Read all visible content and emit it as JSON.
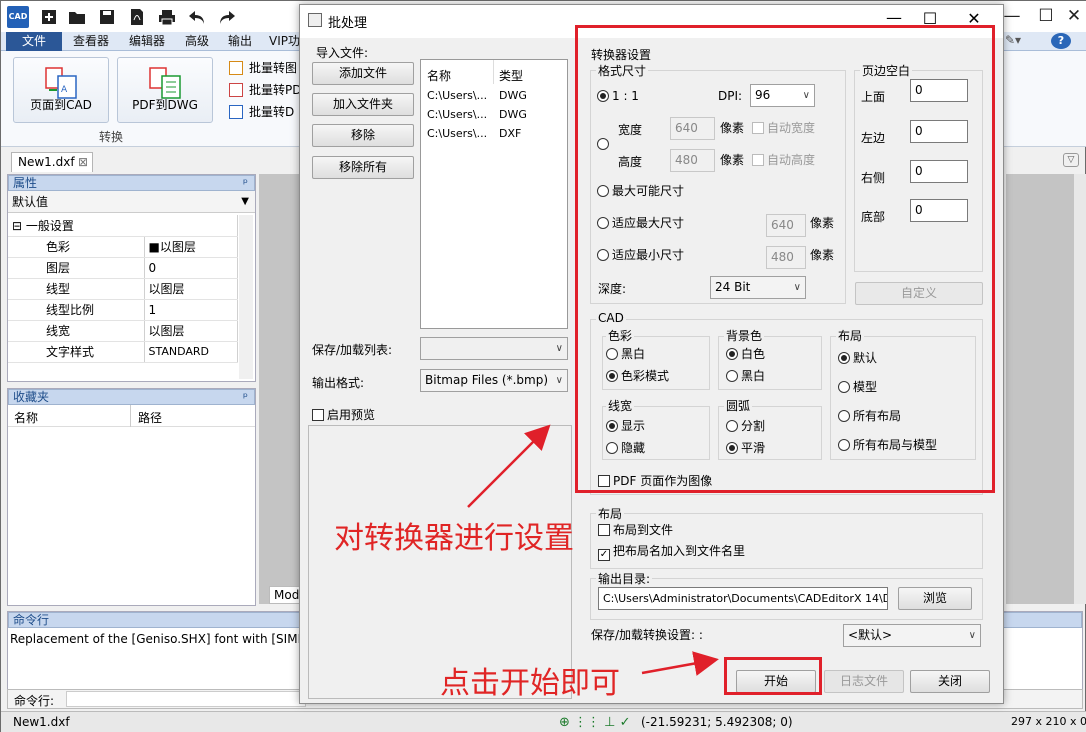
{
  "app": {
    "logo_text": "CAD",
    "menu_tabs": [
      "文件",
      "查看器",
      "编辑器",
      "高级",
      "输出",
      "VIP功"
    ],
    "ribbon": {
      "btn_page_to_cad": "页面到CAD",
      "btn_pdf_to_dwg": "PDF到DWG",
      "group_label": "转换",
      "small_items": [
        "批量转图",
        "批量转PD",
        "批量转D"
      ]
    },
    "doc_tab": "New1.dxf",
    "properties": {
      "title": "属性",
      "selector": "默认值",
      "group": "一般设置",
      "rows": [
        {
          "name": "色彩",
          "value": "■以图层"
        },
        {
          "name": "图层",
          "value": "0"
        },
        {
          "name": "线型",
          "value": "以图层"
        },
        {
          "name": "线型比例",
          "value": "1"
        },
        {
          "name": "线宽",
          "value": "以图层"
        },
        {
          "name": "文字样式",
          "value": "STANDARD"
        }
      ]
    },
    "favorites": {
      "title": "收藏夹",
      "col_name": "名称",
      "col_path": "路径"
    },
    "model_tab": "Mod",
    "command": {
      "title": "命令行",
      "log": "Replacement of the [Geniso.SHX] font with [SIMPLEX.SH",
      "prompt": "命令行:"
    },
    "status": {
      "file": "New1.dxf",
      "coords": "(-21.59231; 5.492308; 0)",
      "paper": "297 x 210 x 0"
    }
  },
  "dialog": {
    "title": "批处理",
    "import_label": "导入文件:",
    "btn_add_file": "添加文件",
    "btn_add_folder": "加入文件夹",
    "btn_remove": "移除",
    "btn_remove_all": "移除所有",
    "files_col_name": "名称",
    "files_col_type": "类型",
    "files": [
      {
        "name": "C:\\Users\\...",
        "type": "DWG"
      },
      {
        "name": "C:\\Users\\...",
        "type": "DWG"
      },
      {
        "name": "C:\\Users\\...",
        "type": "DXF"
      }
    ],
    "save_list_label": "保存/加载列表:",
    "output_format_label": "输出格式:",
    "output_format_value": "Bitmap Files (*.bmp)",
    "preview_label": "启用预览",
    "converter": {
      "title": "转换器设置",
      "format_size": "格式尺寸",
      "opt_1to1": "1 : 1",
      "dpi_label": "DPI:",
      "dpi_value": "96",
      "width_label": "宽度",
      "width_value": "640",
      "height_label": "高度",
      "height_value": "480",
      "pixel": "像素",
      "auto_width": "自动宽度",
      "auto_height": "自动高度",
      "opt_max_possible": "最大可能尺寸",
      "opt_fit_max": "适应最大尺寸",
      "fit_max_value": "640",
      "opt_fit_min": "适应最小尺寸",
      "fit_min_value": "480",
      "depth_label": "深度:",
      "depth_value": "24 Bit",
      "margin_title": "页边空白",
      "margin_top": "上面",
      "margin_left": "左边",
      "margin_right": "右侧",
      "margin_bottom": "底部",
      "margin_values": [
        "0",
        "0",
        "0",
        "0"
      ],
      "btn_custom": "自定义",
      "cad_title": "CAD",
      "color_title": "色彩",
      "color_bw": "黑白",
      "color_mode": "色彩模式",
      "bg_title": "背景色",
      "bg_white": "白色",
      "bg_black": "黑白",
      "layout_title": "布局",
      "layout_default": "默认",
      "layout_model": "模型",
      "layout_all": "所有布局",
      "layout_all_model": "所有布局与模型",
      "lw_title": "线宽",
      "lw_show": "显示",
      "lw_hide": "隐藏",
      "arc_title": "圆弧",
      "arc_split": "分割",
      "arc_smooth": "平滑",
      "pdf_as_image": "PDF 页面作为图像"
    },
    "layout_section": {
      "title": "布局",
      "layout_to_file": "布局到文件",
      "add_layout_name": "把布局名加入到文件名里"
    },
    "output_dir_label": "输出目录:",
    "output_dir_value": "C:\\Users\\Administrator\\Documents\\CADEditorX 14\\D",
    "btn_browse": "浏览",
    "save_settings_label": "保存/加载转换设置: :",
    "save_settings_value": "<默认>",
    "btn_start": "开始",
    "btn_log": "日志文件",
    "btn_close": "关闭"
  },
  "annotations": {
    "configure": "对转换器进行设置",
    "click_start": "点击开始即可"
  },
  "colors": {
    "accent": "#2b5797",
    "annotation": "#e0202a"
  }
}
